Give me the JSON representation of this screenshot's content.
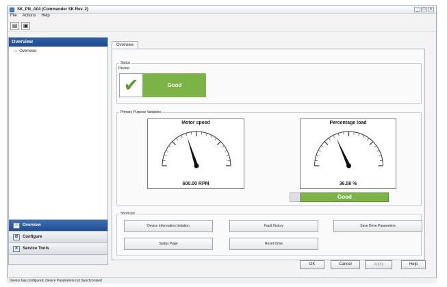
{
  "window": {
    "title": "SK_PN_A04 (Commander SK Rev. 2)",
    "controls": [
      "_",
      "□",
      "×"
    ]
  },
  "menu": [
    "File",
    "Actions",
    "Help"
  ],
  "toolbar": {
    "buttons": [
      {
        "icon": "print-preview-icon",
        "glyph": "▤"
      },
      {
        "icon": "device-icon",
        "glyph": "▣"
      }
    ]
  },
  "sidebar": {
    "header": "Overview",
    "tree": [
      {
        "label": "Overview",
        "icon": "overview-tree-icon"
      }
    ],
    "nav": [
      {
        "label": "Overview",
        "icon": "overview-icon",
        "glyph": "⌂",
        "active": true
      },
      {
        "label": "Configure",
        "icon": "configure-icon",
        "glyph": "⚙",
        "active": false
      },
      {
        "label": "Service Tools",
        "icon": "service-tools-icon",
        "glyph": "✕",
        "active": false
      }
    ]
  },
  "tabs": [
    {
      "label": "Overview",
      "active": true
    }
  ],
  "status": {
    "group_title": "Status",
    "subtitle": "Device:",
    "state": "Good"
  },
  "variables": {
    "group_title": "Primary Purpose Variables",
    "motor_speed": {
      "title": "Motor speed",
      "value_text": "600.00 RPM",
      "value": 600,
      "min": 0,
      "max": 1500
    },
    "percentage_load": {
      "title": "Percentage load",
      "value_text": "36.58 %",
      "value": 36.58,
      "min": 0,
      "max": 100,
      "state": "Good"
    }
  },
  "shortcuts": {
    "group_title": "Shortcuts",
    "buttons": [
      "Device Information Initiation",
      "Fault History",
      "Save Drive Parameters",
      "Status Page",
      "Reset Drive"
    ]
  },
  "footer": {
    "ok": "OK",
    "cancel": "Cancel",
    "apply": "Apply",
    "help": "Help"
  },
  "statusbar": "Device has configured, Device Parameters not Synchronised",
  "colors": {
    "good": "#7bb347",
    "accent": "#1e4a8f"
  }
}
